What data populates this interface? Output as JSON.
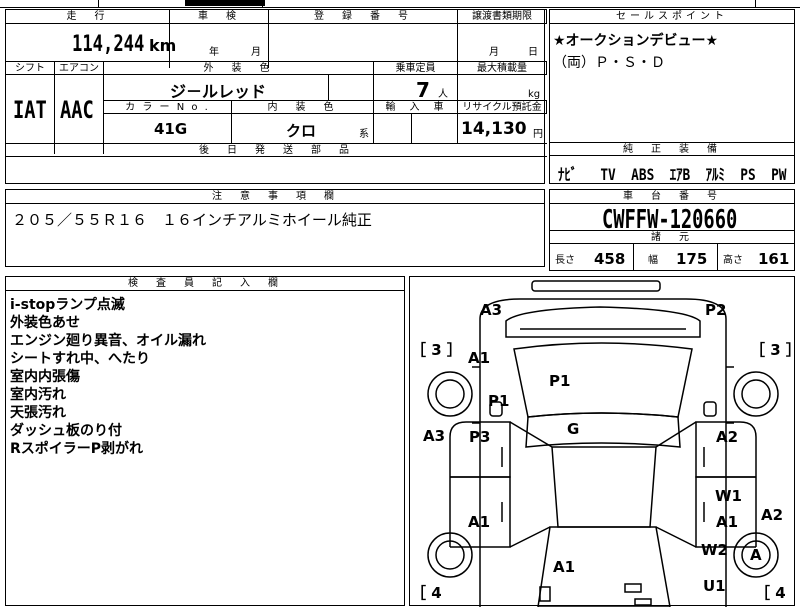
{
  "top": {
    "mileage_header": "走　行",
    "inspection_header": "車　検",
    "registration_header": "登　録　番　号",
    "transfer_header": "譲渡書類期限",
    "mileage_value": "114,244",
    "mileage_unit": "km",
    "inspection_year": "年",
    "inspection_month": "月",
    "transfer_month": "月",
    "transfer_day": "日"
  },
  "spec": {
    "shift_header": "シフト",
    "ac_header": "エアコン",
    "exterior_header": "外　装　色",
    "capacity_header": "乗車定員",
    "maxload_header": "最大積載量",
    "shift_value": "IAT",
    "ac_value": "AAC",
    "exterior_value": "ジ－ルレッド",
    "capacity_value": "7",
    "capacity_unit": "人",
    "maxload_unit": "kg",
    "color_no_header": "カ ラ ー N o .",
    "interior_header": "内　装　色",
    "import_header": "輸　入　車",
    "recycle_header": "リサイクル預託金",
    "color_no_value": "41G",
    "interior_value": "クロ",
    "interior_suffix": "系",
    "recycle_value": "14,130",
    "recycle_unit": "円",
    "later_parts_header": "後　日　発　送　部　品"
  },
  "sales": {
    "header": "セールスポイント",
    "line1": "★オークションデビュー★",
    "line2": "（両）Ｐ・Ｓ・Ｄ"
  },
  "equipment": {
    "header": "純　正　装　備",
    "items": [
      "ﾅﾋﾞ",
      "TV",
      "ABS",
      "ｴｱB",
      "ｱﾙﾐ",
      "PS",
      "PW"
    ]
  },
  "notes_box": {
    "header": "注　意　事　項　欄",
    "text": "２０５／５５Ｒ１６　１６インチアルミホイール純正"
  },
  "chassis": {
    "header": "車　台　番　号",
    "value": "CWFFW-120660",
    "dims_header": "諸　元",
    "length_label": "長さ",
    "length_value": "458",
    "width_label": "幅",
    "width_value": "175",
    "height_label": "高さ",
    "height_value": "161"
  },
  "inspector": {
    "header": "検　査　員　記　入　欄",
    "lines": [
      "i-stopランプ点滅",
      "外装色あせ",
      "エンジン廻り異音、オイル漏れ",
      "シートすれ中、へたり",
      "室内内張傷",
      "室内汚れ",
      "天張汚れ",
      "ダッシュ板のり付",
      "RスポイラーP剥がれ"
    ]
  },
  "diagram": {
    "labels": {
      "a3_top": "A3",
      "p2_top": "P2",
      "a1_left": "A1",
      "p1_left": "P1",
      "p1_roof": "P1",
      "a3_left": "A3",
      "p3": "P3",
      "g": "G",
      "a2_right": "A2",
      "w1": "W1",
      "a1_rdoor": "A1",
      "a2_far": "A2",
      "a1_ldoor": "A1",
      "w2": "W2",
      "a_wheel": "A",
      "a1_rear": "A1",
      "u1": "U1"
    },
    "brackets": {
      "tl": "［ 3 ］",
      "tr": "［ 3 ］",
      "bl": "［ 4",
      "br": "［ 4"
    }
  }
}
